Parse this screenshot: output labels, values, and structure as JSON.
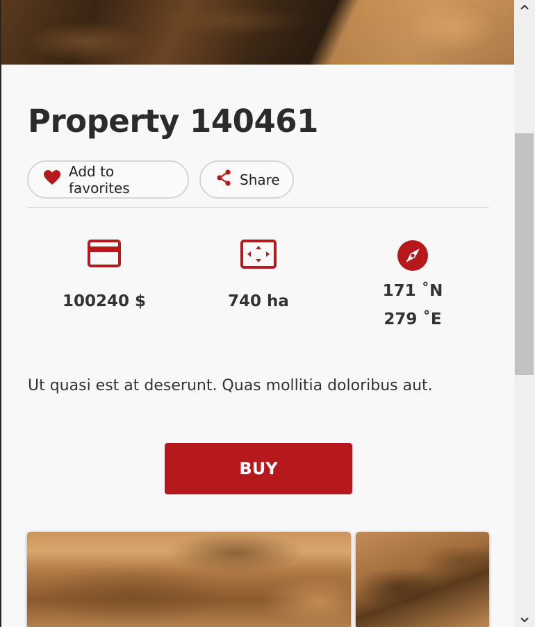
{
  "property": {
    "title": "Property 140461",
    "favorite_label": "Add to favorites",
    "share_label": "Share",
    "price": "100240 $",
    "area": "740 ha",
    "lat": "171 ˚N",
    "lon": "279 ˚E",
    "description": "Ut quasi est at deserunt. Quas mollitia doloribus aut.",
    "buy_label": "BUY"
  },
  "icons": {
    "favorite": "heart-icon",
    "share": "share-icon",
    "price": "credit-card-icon",
    "area": "expand-area-icon",
    "location": "compass-icon",
    "scroll_up": "chevron-up-icon",
    "scroll_down": "chevron-down-icon"
  },
  "colors": {
    "accent": "#b5191b",
    "text": "#333333",
    "background": "#f8f8f8"
  }
}
